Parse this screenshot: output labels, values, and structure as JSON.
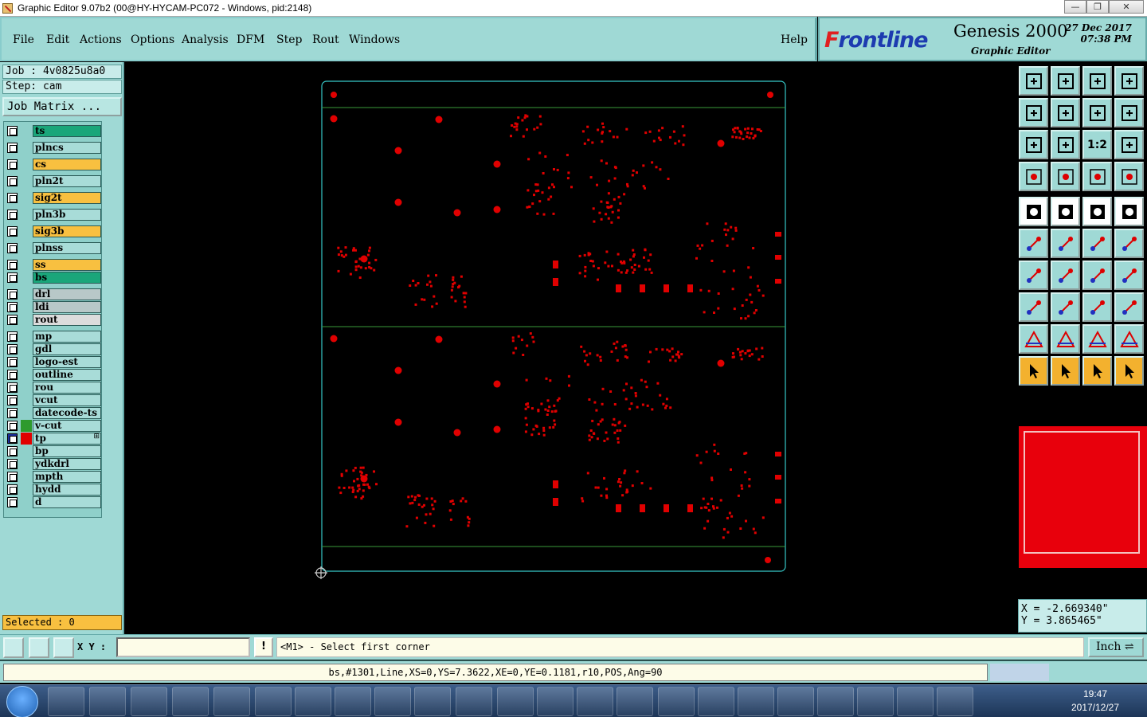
{
  "window": {
    "title": "Graphic Editor 9.07b2 (00@HY-HYCAM-PC072 - Windows, pid:2148)",
    "buttons": [
      "—",
      "❐",
      "✕"
    ]
  },
  "menu": {
    "items": [
      "File",
      "Edit",
      "Actions",
      "Options",
      "Analysis",
      "DFM",
      "Step",
      "Rout",
      "Windows"
    ],
    "help": "Help"
  },
  "brand": {
    "logo_prefix": "F",
    "logo_rest": "rontline",
    "product": "Genesis 2000",
    "subtitle": "Graphic Editor",
    "date": "27 Dec 2017",
    "time": "07:38 PM"
  },
  "job": {
    "job_line": "Job : 4v0825u8a0",
    "step_line": "Step: cam",
    "matrix_button": "Job Matrix ..."
  },
  "layers": [
    {
      "name": "ts",
      "color": "#1aa67a"
    },
    {
      "name": "plncs",
      "color": "#a8dcd8"
    },
    {
      "name": "cs",
      "color": "#f8c040"
    },
    {
      "name": "pln2t",
      "color": "#a8dcd8"
    },
    {
      "name": "sig2t",
      "color": "#f8c040"
    },
    {
      "name": "pln3b",
      "color": "#a8dcd8"
    },
    {
      "name": "sig3b",
      "color": "#f8c040"
    },
    {
      "name": "plnss",
      "color": "#a8dcd8"
    },
    {
      "name": "ss",
      "color": "#f8c040"
    },
    {
      "name": "bs",
      "color": "#1aa67a"
    },
    {
      "name": "drl",
      "color": "#b8c8c8"
    },
    {
      "name": "ldi",
      "color": "#b8c8c8"
    },
    {
      "name": "rout",
      "color": "#dcdcdc"
    },
    {
      "name": "mp",
      "color": "#a8dcd8"
    },
    {
      "name": "gdl",
      "color": "#a8dcd8"
    },
    {
      "name": "logo-est",
      "color": "#a8dcd8"
    },
    {
      "name": "outline",
      "color": "#a8dcd8"
    },
    {
      "name": "rou",
      "color": "#a8dcd8"
    },
    {
      "name": "vcut",
      "color": "#a8dcd8"
    },
    {
      "name": "datecode-ts",
      "color": "#a8dcd8"
    },
    {
      "name": "v-cut",
      "color": "#a8dcd8",
      "swatch": "#2e9a2e"
    },
    {
      "name": "tp",
      "color": "#a8dcd8",
      "swatch": "#e00000",
      "marker": "⊞",
      "active": true
    },
    {
      "name": "bp",
      "color": "#a8dcd8"
    },
    {
      "name": "ydkdrl",
      "color": "#a8dcd8"
    },
    {
      "name": "mpth",
      "color": "#a8dcd8"
    },
    {
      "name": "hydd",
      "color": "#a8dcd8"
    },
    {
      "name": "d",
      "color": "#a8dcd8"
    }
  ],
  "selected": "Selected : 0",
  "coords": {
    "x": "X = -2.669340\"",
    "y": "Y = 3.865465\""
  },
  "command": {
    "xy_label": "X Y :",
    "xy_value": "",
    "warn": "!",
    "prompt": "<M1> - Select first corner",
    "unit": "Inch"
  },
  "status": "bs,#1301,Line,XS=0,YS=7.3622,XE=0,YE=0.1181,r10,POS,Ang=90",
  "clock": {
    "time": "19:47",
    "date": "2017/12/27"
  },
  "tools": [
    "view-home-icon",
    "view-download-icon",
    "view-house-icon",
    "view-grid-icon",
    "view-left-icon",
    "view-right-icon",
    "view-mirror-icon",
    "view-swap-icon",
    "zoom-fit-icon",
    "zoom-center-icon",
    "zoom-1-2-icon",
    "help-query-icon",
    "pan-tool-icon",
    "measure-pin-icon",
    "layer-red-icon",
    "layer-red2-icon",
    "pad-square-icon",
    "edit-shape-icon",
    "ruler-icon",
    "dot-icon",
    "net-icon",
    "cross-icon",
    "line-red-icon",
    "line-red2-icon",
    "angle-icon",
    "slash-icon",
    "rotate-icon",
    "ff-icon",
    "snap-icon",
    "minus-icon",
    "stretch-icon",
    "cluster-icon",
    "triangle-icon",
    "triangle2-icon",
    "triangle3-icon",
    "triangle4-icon",
    "select-arrow-icon",
    "select-arrow2-icon",
    "select-arrow3-icon",
    "select-multi-icon"
  ],
  "zoom_ratio": "1:2",
  "colors": {
    "panel": "#9fd9d5",
    "accent": "#e00000",
    "outline": "#36c8c8",
    "highlight": "#f8c040"
  }
}
